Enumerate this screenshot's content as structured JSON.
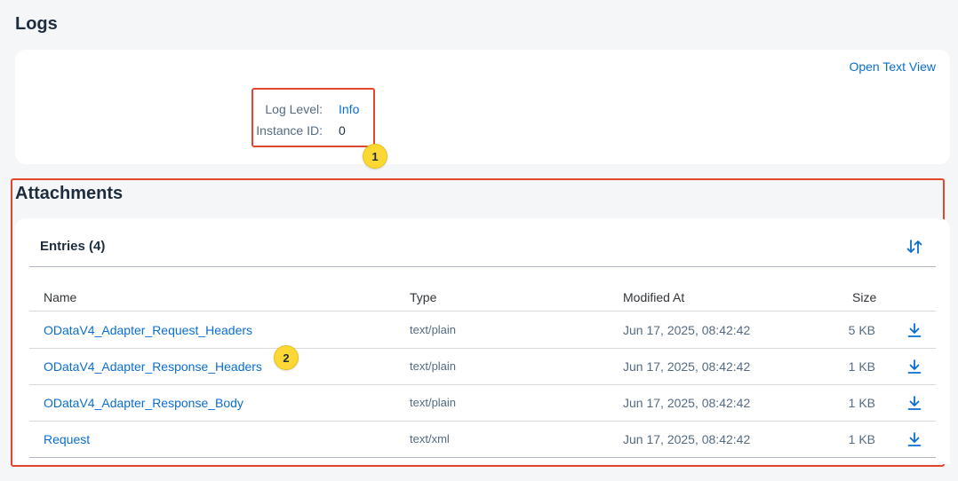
{
  "logs": {
    "title": "Logs",
    "open_text_view": "Open Text View",
    "log_level_label": "Log Level:",
    "log_level_value": "Info",
    "instance_id_label": "Instance ID:",
    "instance_id_value": "0"
  },
  "markers": {
    "one": "1",
    "two": "2"
  },
  "attachments": {
    "title": "Attachments",
    "entries_title": "Entries (4)",
    "columns": {
      "name": "Name",
      "type": "Type",
      "modified": "Modified At",
      "size": "Size"
    },
    "rows": [
      {
        "name": "ODataV4_Adapter_Request_Headers",
        "type": "text/plain",
        "modified": "Jun 17, 2025, 08:42:42",
        "size": "5 KB"
      },
      {
        "name": "ODataV4_Adapter_Response_Headers",
        "type": "text/plain",
        "modified": "Jun 17, 2025, 08:42:42",
        "size": "1 KB"
      },
      {
        "name": "ODataV4_Adapter_Response_Body",
        "type": "text/plain",
        "modified": "Jun 17, 2025, 08:42:42",
        "size": "1 KB"
      },
      {
        "name": "Request",
        "type": "text/xml",
        "modified": "Jun 17, 2025, 08:42:42",
        "size": "1 KB"
      }
    ]
  },
  "icons": {
    "sort": "sort-icon",
    "download": "download-icon"
  },
  "colors": {
    "link": "#0a6ed1",
    "highlight": "#e2462c",
    "marker": "#fdd835"
  }
}
